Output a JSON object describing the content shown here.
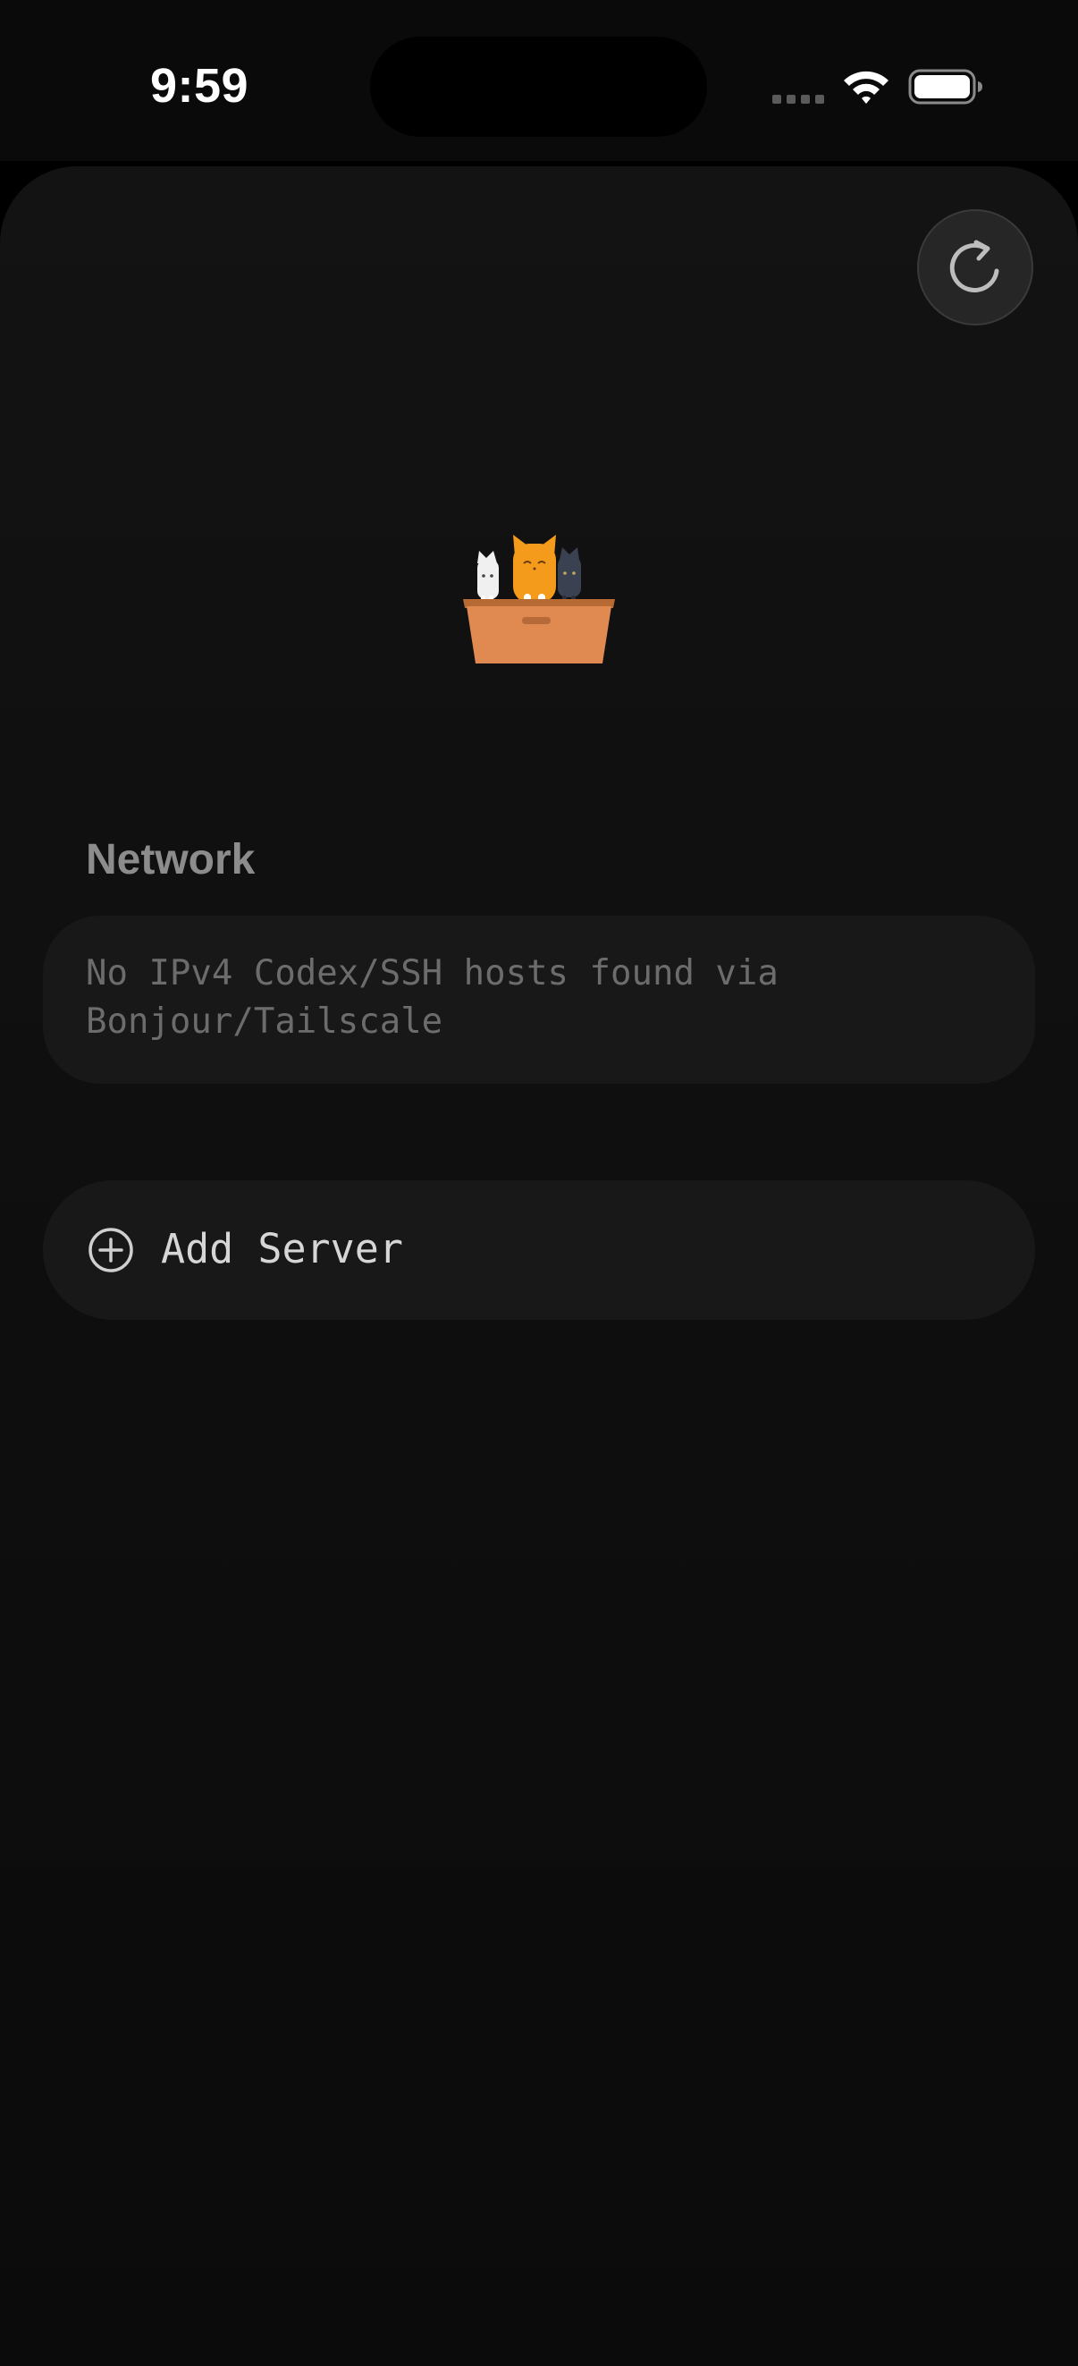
{
  "status_bar": {
    "time": "9:59"
  },
  "colors": {
    "background": "#0e0e0e",
    "card": "#181818",
    "section_header": "#8c8c8c",
    "muted_text": "#6c6c6c",
    "button_text": "#d6d6d6"
  },
  "toolbar": {
    "refresh_icon": "refresh-icon"
  },
  "hero": {
    "icon": "cats-in-box-logo"
  },
  "network_section": {
    "header": "Network",
    "empty_message": "No IPv4 Codex/SSH hosts found via\nBonjour/Tailscale"
  },
  "add_server": {
    "icon": "plus-circle-icon",
    "label": "Add Server"
  }
}
